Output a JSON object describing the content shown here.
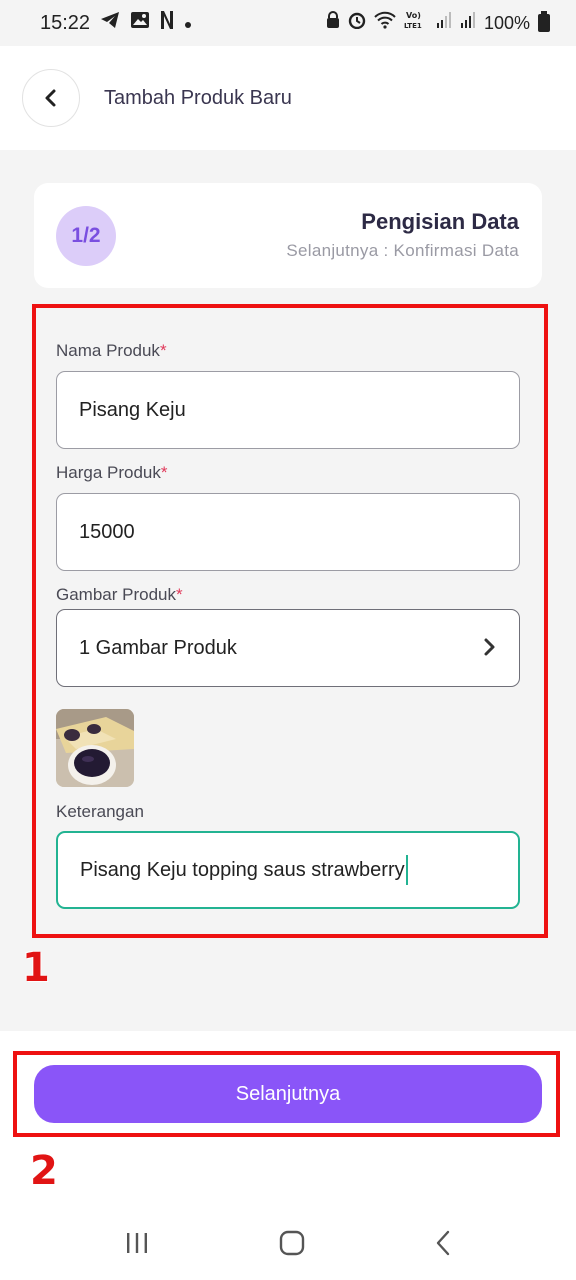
{
  "status_bar": {
    "time": "15:22",
    "battery": "100%"
  },
  "header": {
    "title": "Tambah Produk Baru"
  },
  "step": {
    "badge": "1/2",
    "title": "Pengisian Data",
    "subtitle": "Selanjutnya : Konfirmasi Data"
  },
  "form": {
    "name_label": "Nama Produk",
    "name_value": "Pisang Keju",
    "price_label": "Harga Produk",
    "price_value": "15000",
    "image_label": "Gambar Produk",
    "image_value": "1 Gambar Produk",
    "note_label": "Keterangan",
    "note_value": "Pisang Keju topping saus strawberry",
    "required_mark": "*"
  },
  "actions": {
    "next_label": "Selanjutnya"
  },
  "annotations": {
    "marker_1": "1",
    "marker_2": "2"
  },
  "colors": {
    "accent": "#8a55f8",
    "badge_bg": "#dccdf9",
    "focus": "#22b392",
    "annotation": "#ee1111"
  },
  "icons": {
    "status_left": [
      "telegram-icon",
      "gallery-icon",
      "netflix-icon",
      "dot-icon"
    ],
    "status_right": [
      "lock-icon",
      "alarm-icon",
      "wifi-icon",
      "volte-icon",
      "signal-icon",
      "signal-icon",
      "battery-icon"
    ],
    "image_field": "chevron-right-icon",
    "nav": [
      "recents-icon",
      "home-icon",
      "back-icon"
    ]
  }
}
